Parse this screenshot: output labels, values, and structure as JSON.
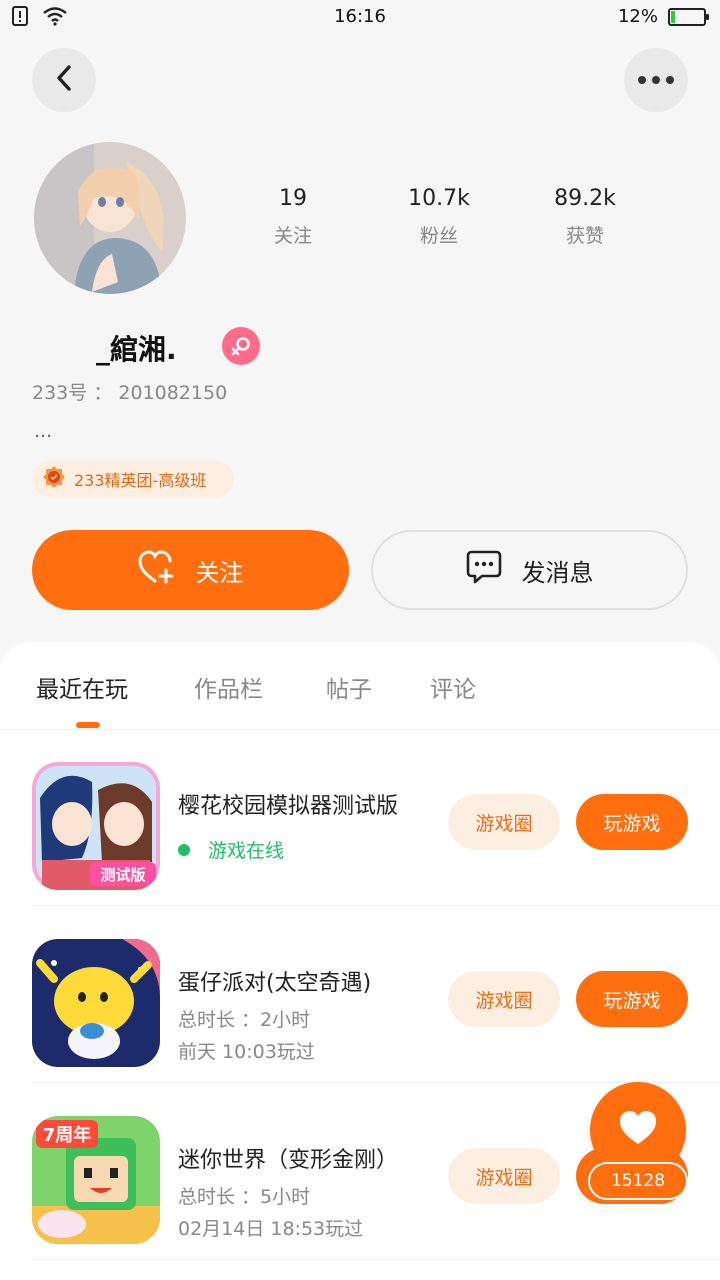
{
  "status": {
    "time": "16:16",
    "battery": "12%",
    "battery_level": 0.12
  },
  "profile": {
    "username": "_綰湘.",
    "uid_label": "233号",
    "uid_value": "201082150",
    "bio": "...",
    "badge": "233精英团-高级班",
    "stats": [
      {
        "value": "19",
        "label": "关注"
      },
      {
        "value": "10.7k",
        "label": "粉丝"
      },
      {
        "value": "89.2k",
        "label": "获赞"
      }
    ]
  },
  "actions": {
    "follow": "关注",
    "message": "发消息"
  },
  "tabs": [
    "最近在玩",
    "作品栏",
    "帖子",
    "评论"
  ],
  "games": [
    {
      "title": "樱花校园模拟器测试版",
      "line1": "游戏在线",
      "line2": "",
      "circle": "游戏圈",
      "play": "玩游戏"
    },
    {
      "title": "蛋仔派对(太空奇遇)",
      "line1": "总时长 ：2小时",
      "line2": "前天 10:03玩过",
      "circle": "游戏圈",
      "play": "玩游戏"
    },
    {
      "title": "迷你世界（变形金刚）",
      "line1": "总时长 ：5小时",
      "line2": "02月14日 18:53玩过",
      "circle": "游戏圈",
      "play": "玩游戏"
    }
  ],
  "icon_labels": {
    "game1": "测试版",
    "game3": "7周年"
  },
  "like": {
    "count": "15128"
  },
  "colors": {
    "accent": "#ff6f0f",
    "online": "#1fbf6a",
    "female": "#ff6b8b"
  }
}
